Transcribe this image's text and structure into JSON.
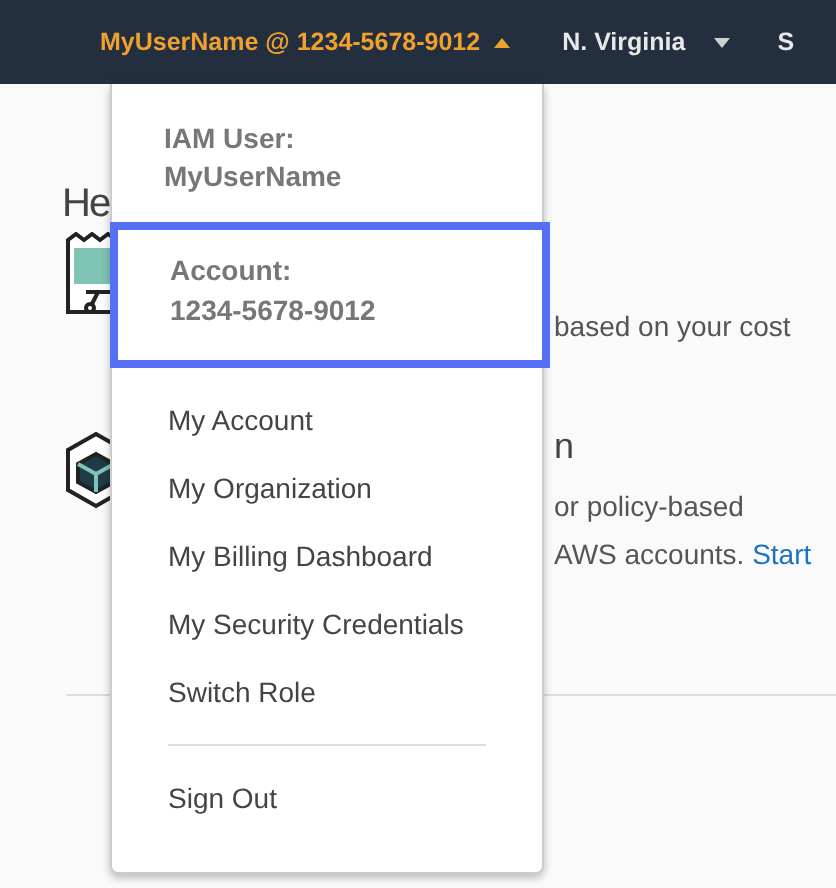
{
  "top_bar": {
    "account_menu": {
      "label": "MyUserName @ 1234-5678-9012",
      "open": true
    },
    "region_menu": {
      "label": "N. Virginia"
    },
    "cut_item": "S"
  },
  "background": {
    "heading": "He",
    "rows": [
      {
        "kind": "receipt",
        "title": "",
        "lines": [
          "based on your cost"
        ],
        "link": ""
      },
      {
        "kind": "cube",
        "title": "n",
        "lines": [
          "or policy-based",
          "AWS accounts."
        ],
        "link": "Start"
      }
    ]
  },
  "dropdown": {
    "user_label": "IAM User:",
    "user_name": "MyUserName",
    "account_label": "Account:",
    "account_number": "1234-5678-9012",
    "account_highlighted": true,
    "items": [
      "My Account",
      "My Organization",
      "My Billing Dashboard",
      "My Security Credentials",
      "Switch Role"
    ],
    "sign_out": "Sign Out"
  }
}
